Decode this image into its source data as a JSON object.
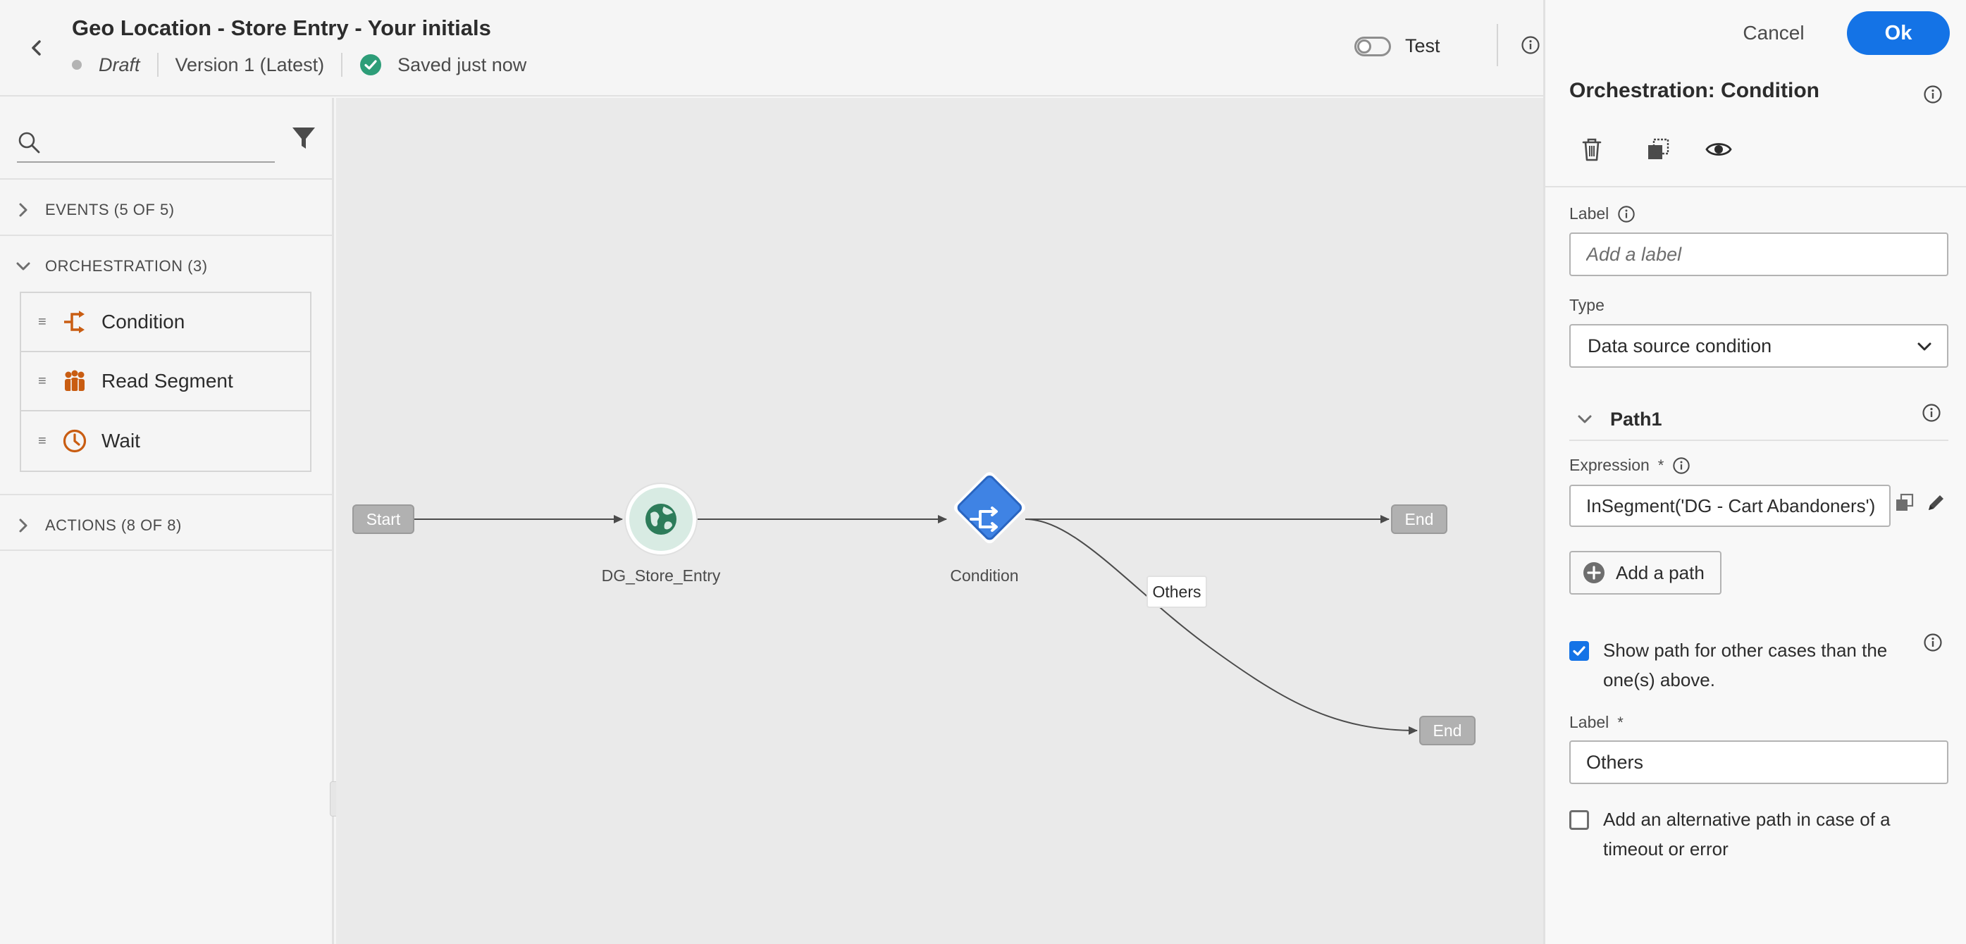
{
  "header": {
    "title": "Geo Location - Store Entry - Your initials",
    "status": "Draft",
    "version": "Version 1 (Latest)",
    "saved": "Saved just now",
    "test_label": "Test",
    "test_enabled": false
  },
  "palette": {
    "search_placeholder": "",
    "sections": {
      "events": "EVENTS (5 OF 5)",
      "orchestration": "ORCHESTRATION (3)",
      "actions": "ACTIONS (8 OF 8)"
    },
    "orchestration_items": [
      {
        "label": "Condition",
        "icon": "condition-icon"
      },
      {
        "label": "Read Segment",
        "icon": "read-segment-icon"
      },
      {
        "label": "Wait",
        "icon": "wait-icon"
      }
    ]
  },
  "canvas": {
    "start_label": "Start",
    "event_node_label": "DG_Store_Entry",
    "event_node_icon": "globe-icon",
    "condition_node_label": "Condition",
    "condition_node_icon": "condition-split-icon",
    "end1_label": "End",
    "end2_label": "End",
    "others_link_label": "Others"
  },
  "panel": {
    "cancel_label": "Cancel",
    "ok_label": "Ok",
    "title": "Orchestration: Condition",
    "label_field_label": "Label",
    "label_field_placeholder": "Add a label",
    "label_field_value": "",
    "type_label": "Type",
    "type_value": "Data source condition",
    "path_name": "Path1",
    "expression_label": "Expression",
    "required_mark": "*",
    "expression_value": "InSegment('DG - Cart Abandoners')",
    "add_path_label": "Add a path",
    "show_other_label": "Show path for other cases than the one(s) above.",
    "show_other_checked": true,
    "other_label_label": "Label",
    "other_label_value": "Others",
    "alt_path_label": "Add an alternative path in case of a timeout or error",
    "alt_path_checked": false
  },
  "colors": {
    "accent": "#1473e6",
    "orchestration_icon": "#c95d12",
    "event_node_bg": "#d8ebe3",
    "event_node_icon": "#2d7c5a",
    "saved_check": "#2d9d78"
  }
}
